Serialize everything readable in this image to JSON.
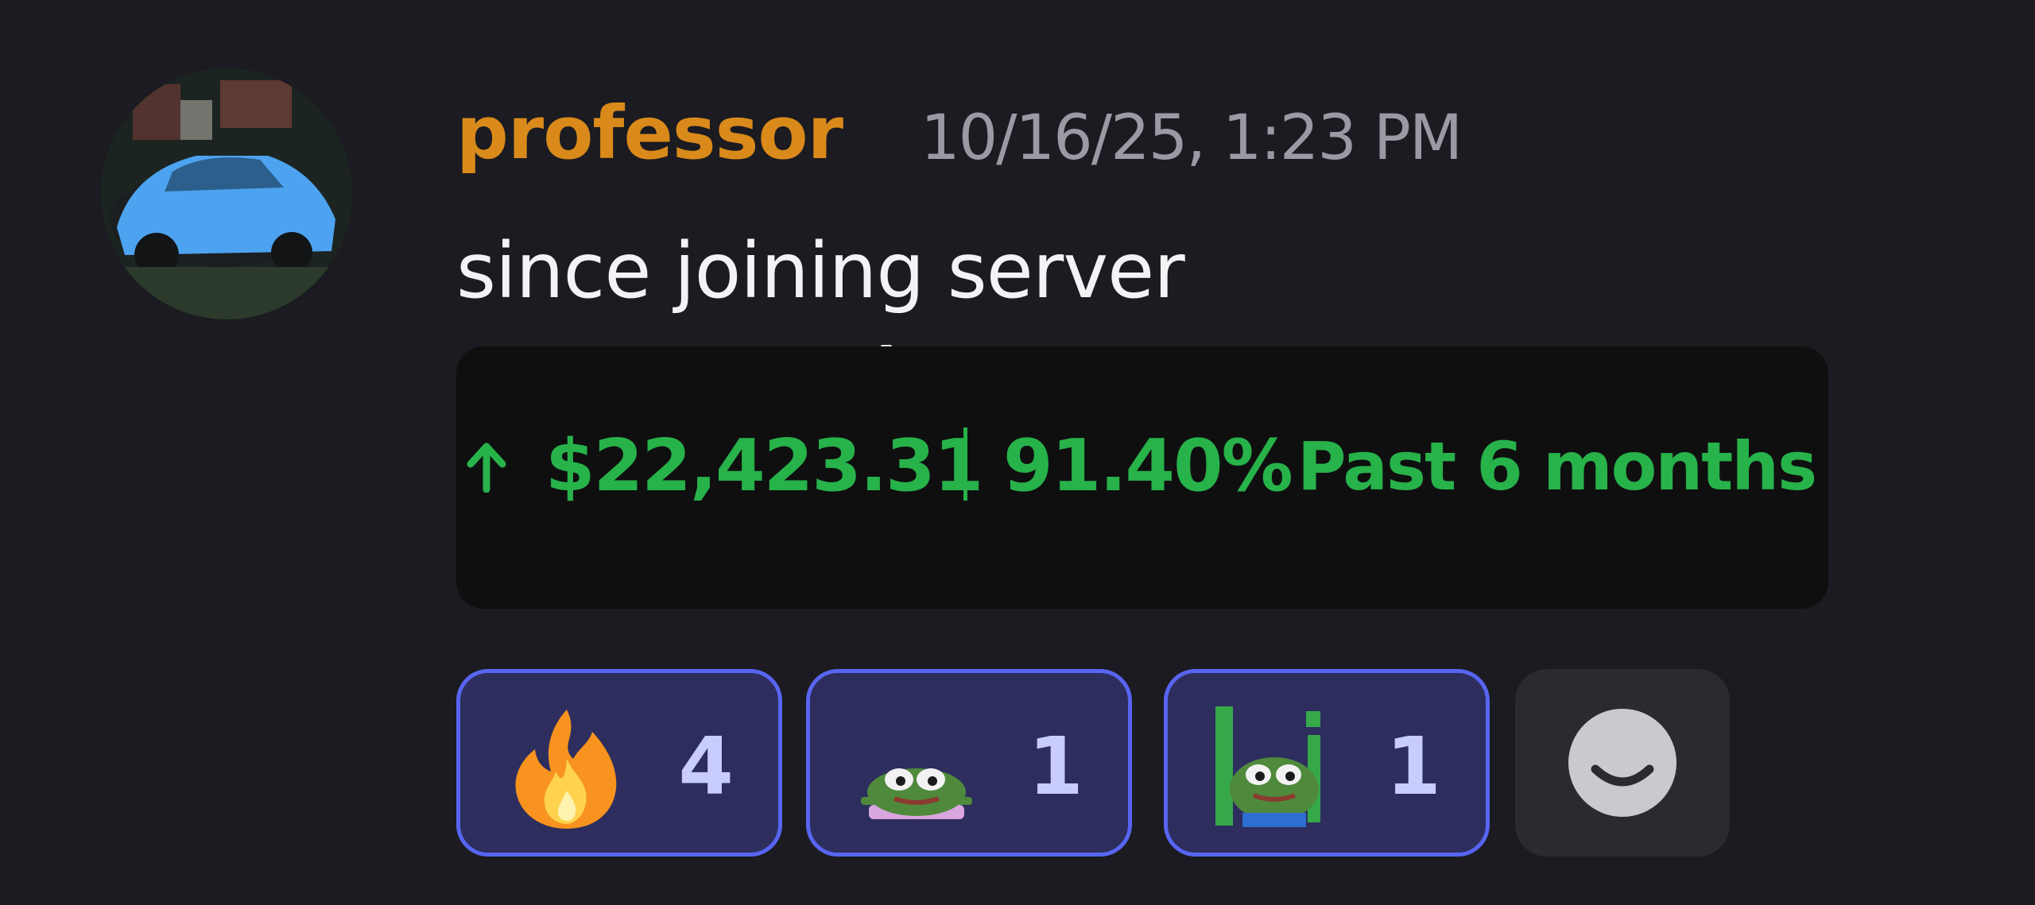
{
  "message": {
    "author": "professor",
    "timestamp": "10/16/25, 1:23 PM",
    "text": "since joining server",
    "author_color": "#d98a1a"
  },
  "embed": {
    "direction_icon": "arrow-up-icon",
    "amount": "$22,423.31",
    "separator": "|",
    "percent": "91.40%",
    "period": "Past 6 months",
    "color": "#27b24a"
  },
  "reactions": [
    {
      "emoji": "fire-emoji",
      "count": "4"
    },
    {
      "emoji": "pepe-frog-emoji",
      "count": "1"
    },
    {
      "emoji": "pepe-frog-sign-emoji",
      "count": "1"
    }
  ],
  "add_reaction": {
    "icon": "smiley-face-icon"
  }
}
